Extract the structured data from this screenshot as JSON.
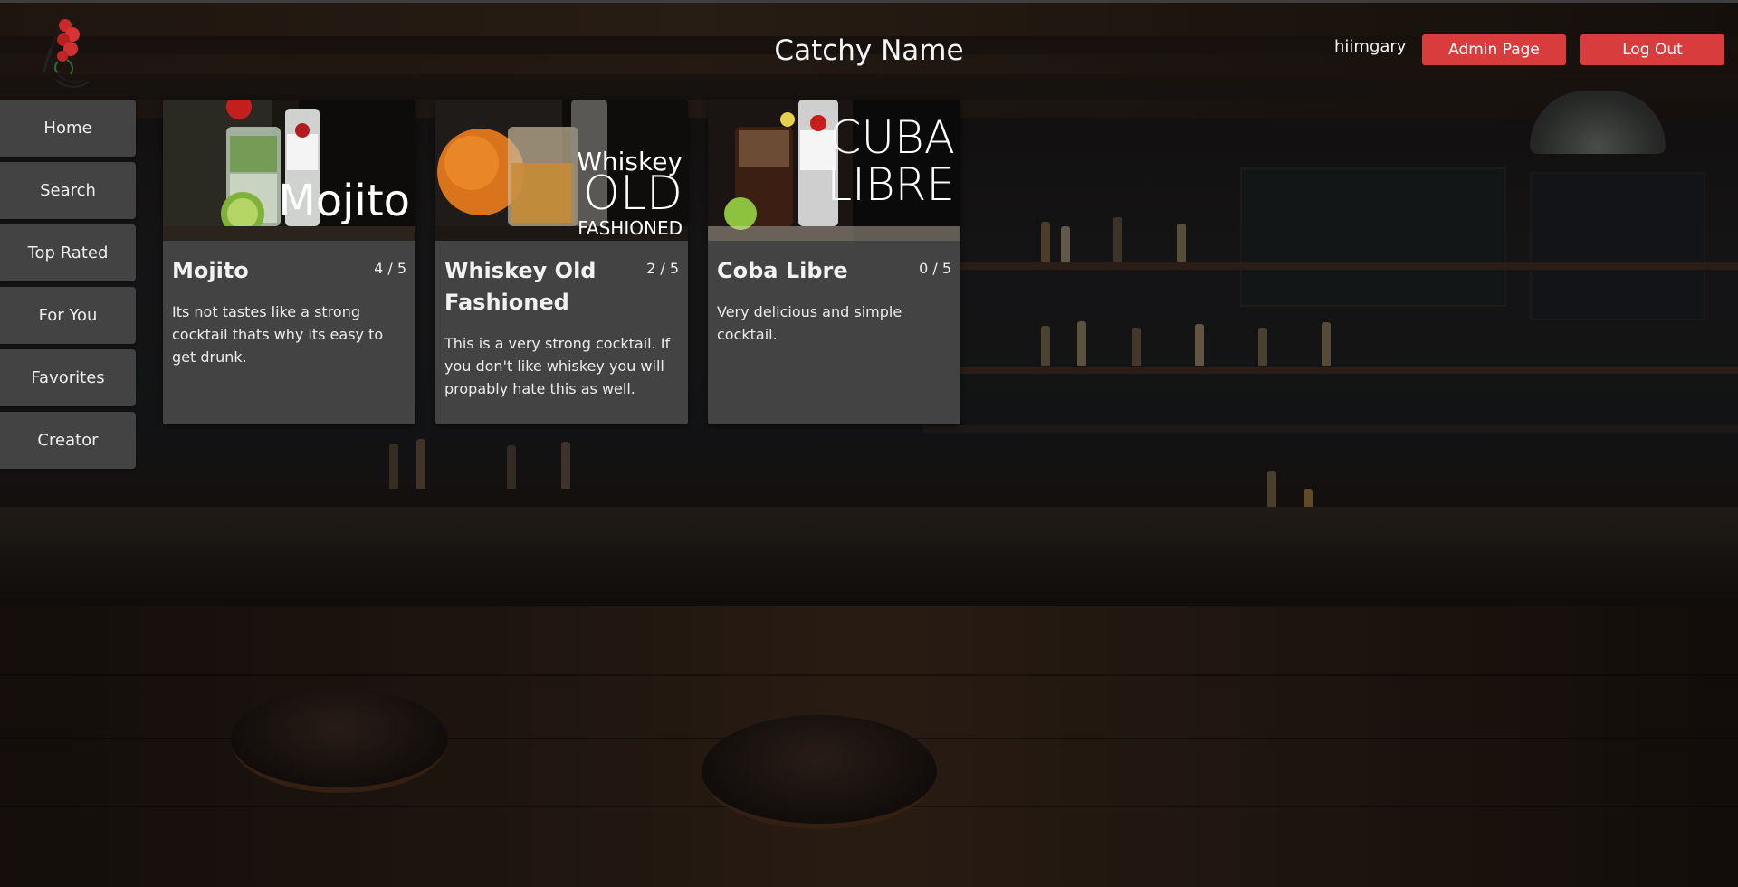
{
  "header": {
    "title": "Catchy Name",
    "username": "hiimgary",
    "admin_label": "Admin Page",
    "logout_label": "Log Out"
  },
  "sidebar": {
    "items": [
      {
        "label": "Home"
      },
      {
        "label": "Search"
      },
      {
        "label": "Top Rated"
      },
      {
        "label": "For You"
      },
      {
        "label": "Favorites"
      },
      {
        "label": "Creator"
      }
    ]
  },
  "cards": [
    {
      "name": "Mojito",
      "rating": "4 / 5",
      "description": "Its not tastes like a strong cocktail thats why its easy to get drunk.",
      "image_text": "Mojito"
    },
    {
      "name": "Whiskey Old Fashioned",
      "rating": "2 / 5",
      "description": "This is a very strong cocktail. If you don't like whiskey you will propably hate this as well.",
      "image_text_top": "Whiskey",
      "image_text_mid": "OLD",
      "image_text_bottom": "FASHIONED"
    },
    {
      "name": "Coba Libre",
      "rating": "0 / 5",
      "description": "Very delicious and simple cocktail.",
      "image_text_top": "CUBA",
      "image_text_bottom": "LIBRE"
    }
  ],
  "colors": {
    "accent": "#d83c3c",
    "panel": "#434343",
    "text": "#f2f2f2"
  },
  "icons": {
    "logo": "rose-logo-icon"
  }
}
